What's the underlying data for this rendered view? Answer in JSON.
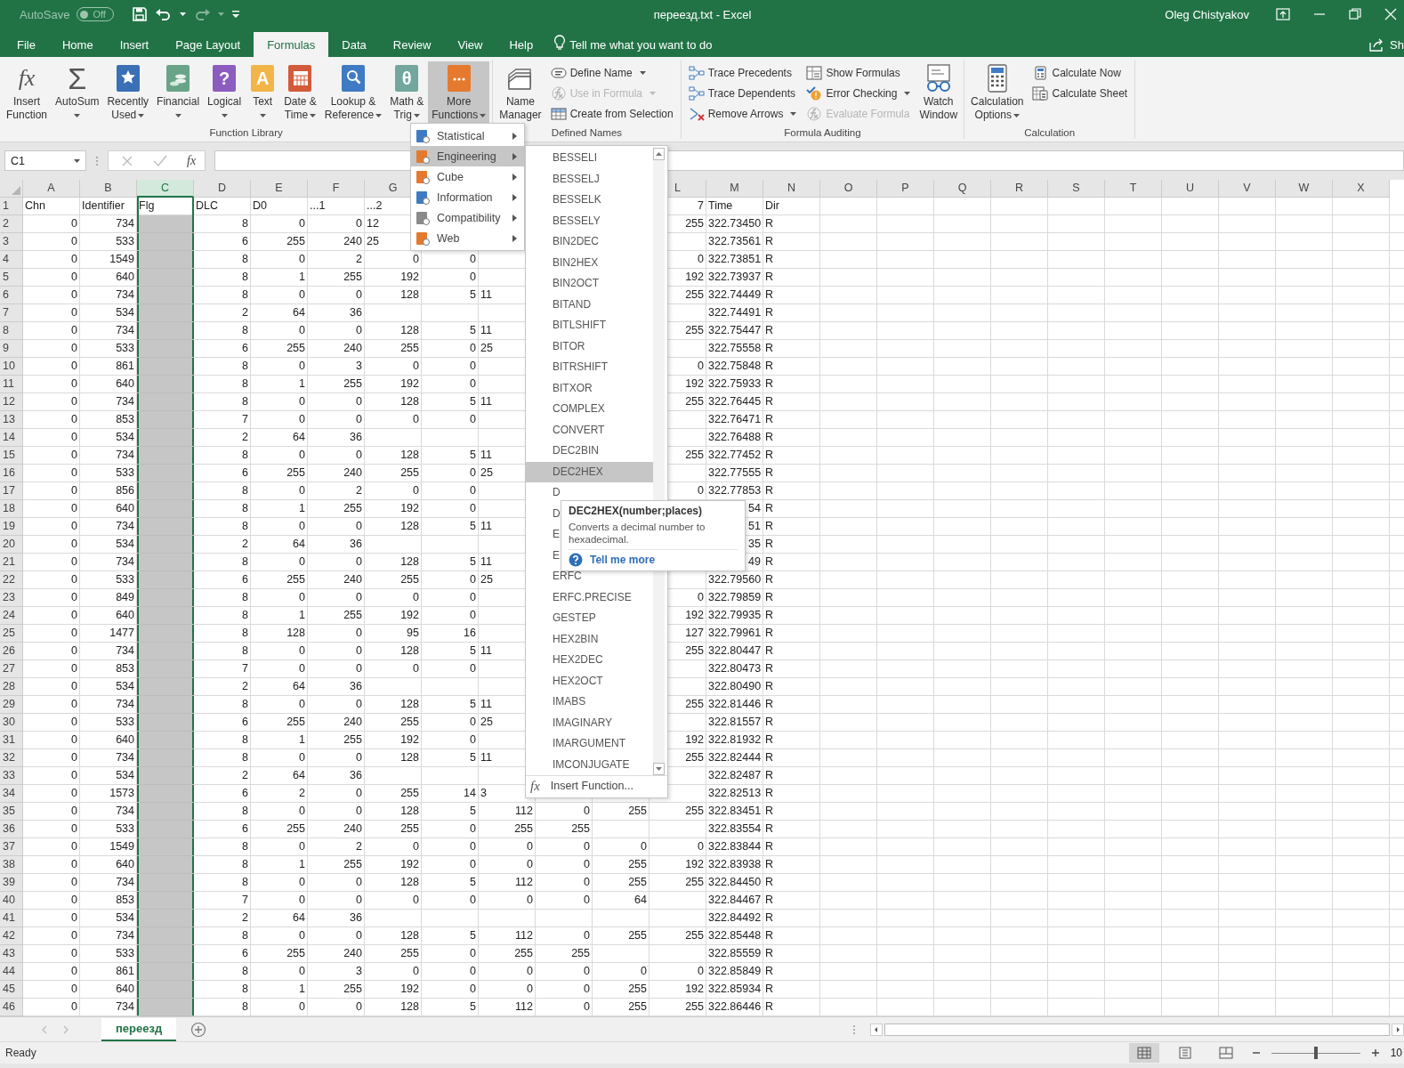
{
  "title_bar": {
    "autosave_label": "AutoSave",
    "autosave": {
      "on": false,
      "label": "Off"
    },
    "title": "переезд.txt - Excel",
    "user": "Oleg Chistyakov"
  },
  "tabs": [
    {
      "label": "File",
      "selected": false
    },
    {
      "label": "Home",
      "selected": false
    },
    {
      "label": "Insert",
      "selected": false
    },
    {
      "label": "Page Layout",
      "selected": false
    },
    {
      "label": "Formulas",
      "selected": true
    },
    {
      "label": "Data",
      "selected": false
    },
    {
      "label": "Review",
      "selected": false
    },
    {
      "label": "View",
      "selected": false
    },
    {
      "label": "Help",
      "selected": false
    }
  ],
  "tell_me": {
    "placeholder": "Tell me what you want to do"
  },
  "share": {
    "label": "Sh"
  },
  "ribbon_groups": [
    {
      "name": "Function Library",
      "items": [
        {
          "kind": "large",
          "lines": [
            "Insert",
            "Function"
          ],
          "glyph": "fx",
          "caret": false,
          "pressed": false
        },
        {
          "kind": "large",
          "lines": [
            "AutoSum"
          ],
          "glyph": "Σ",
          "caret": true,
          "pressed": false
        },
        {
          "kind": "large",
          "lines": [
            "Recently",
            "Used"
          ],
          "caret": true,
          "pressed": false
        },
        {
          "kind": "large",
          "lines": [
            "Financial"
          ],
          "caret": true,
          "pressed": false
        },
        {
          "kind": "large",
          "lines": [
            "Logical"
          ],
          "glyph": "?",
          "caret": true,
          "pressed": false
        },
        {
          "kind": "large",
          "lines": [
            "Text"
          ],
          "glyph": "A",
          "caret": true,
          "pressed": false
        },
        {
          "kind": "large",
          "lines": [
            "Date &",
            "Time"
          ],
          "caret": true,
          "pressed": false
        },
        {
          "kind": "large",
          "lines": [
            "Lookup &",
            "Reference"
          ],
          "caret": true,
          "pressed": false
        },
        {
          "kind": "large",
          "lines": [
            "Math &",
            "Trig"
          ],
          "glyph": "θ",
          "caret": true,
          "pressed": false
        },
        {
          "kind": "large",
          "lines": [
            "More",
            "Functions"
          ],
          "caret": true,
          "pressed": true
        }
      ]
    },
    {
      "name": "Defined Names",
      "items": [
        {
          "kind": "large",
          "lines": [
            "Name",
            "Manager"
          ],
          "caret": false,
          "pressed": false
        },
        {
          "kind": "stack",
          "buttons": [
            {
              "label": "Define Name",
              "caret": true,
              "disabled": false
            },
            {
              "label": "Use in Formula",
              "caret": true,
              "disabled": true
            },
            {
              "label": "Create from Selection",
              "caret": false,
              "disabled": false
            }
          ]
        }
      ]
    },
    {
      "name": "Formula Auditing",
      "items": [
        {
          "kind": "stack",
          "buttons": [
            {
              "label": "Trace Precedents",
              "caret": false,
              "disabled": false
            },
            {
              "label": "Trace Dependents",
              "caret": false,
              "disabled": false
            },
            {
              "label": "Remove Arrows",
              "caret": true,
              "disabled": false
            }
          ]
        },
        {
          "kind": "stack",
          "buttons": [
            {
              "label": "Show Formulas",
              "caret": false,
              "disabled": false
            },
            {
              "label": "Error Checking",
              "caret": true,
              "disabled": false
            },
            {
              "label": "Evaluate Formula",
              "caret": false,
              "disabled": true
            }
          ]
        },
        {
          "kind": "large",
          "lines": [
            "Watch",
            "Window"
          ],
          "caret": false,
          "pressed": false
        }
      ]
    },
    {
      "name": "Calculation",
      "items": [
        {
          "kind": "large",
          "lines": [
            "Calculation",
            "Options"
          ],
          "caret": true,
          "pressed": false
        },
        {
          "kind": "stack",
          "buttons": [
            {
              "label": "Calculate Now",
              "caret": false,
              "disabled": false
            },
            {
              "label": "Calculate Sheet",
              "caret": false,
              "disabled": false
            }
          ]
        }
      ]
    }
  ],
  "formula_bar": {
    "name_box": "C1",
    "fx": "fx"
  },
  "grid": {
    "columns": [
      {
        "label": "A",
        "selected": false
      },
      {
        "label": "B",
        "selected": false
      },
      {
        "label": "C",
        "selected": true
      },
      {
        "label": "D",
        "selected": false
      },
      {
        "label": "E",
        "selected": false
      },
      {
        "label": "F",
        "selected": false
      },
      {
        "label": "G",
        "selected": false
      },
      {},
      {},
      {},
      {},
      {
        "label": "L",
        "selected": false
      },
      {
        "label": "M",
        "selected": false
      },
      {
        "label": "N",
        "selected": false
      },
      {
        "label": "O",
        "selected": false
      },
      {
        "label": "P",
        "selected": false
      },
      {
        "label": "Q",
        "selected": false
      },
      {
        "label": "R",
        "selected": false
      },
      {
        "label": "S",
        "selected": false
      },
      {
        "label": "T",
        "selected": false
      },
      {
        "label": "U",
        "selected": false
      },
      {
        "label": "V",
        "selected": false
      },
      {
        "label": "W",
        "selected": false
      },
      {
        "label": "X",
        "selected": false
      }
    ],
    "rows": [
      {
        "n": "1",
        "cells": [
          "Chn",
          "Identifier",
          "Flg",
          "DLC",
          "D0",
          "...1",
          "...2",
          null,
          null,
          null,
          null,
          {
            "text": "7",
            "cut": true
          },
          "Time",
          "Dir"
        ]
      },
      {
        "n": "2",
        "cells": [
          "0",
          "734",
          null,
          "8",
          "0",
          "0",
          {
            "text": "12",
            "cut": true
          },
          null,
          null,
          null,
          null,
          "255",
          "322.73450",
          "R"
        ]
      },
      {
        "n": "3",
        "cells": [
          "0",
          "533",
          null,
          "6",
          "255",
          "240",
          {
            "text": "25",
            "cut": true
          },
          null,
          null,
          null,
          null,
          null,
          "322.73561",
          "R"
        ]
      },
      {
        "n": "4",
        "cells": [
          "0",
          "1549",
          null,
          "8",
          "0",
          "2",
          "0",
          "0",
          null,
          null,
          null,
          "0",
          "322.73851",
          "R"
        ]
      },
      {
        "n": "5",
        "cells": [
          "0",
          "640",
          null,
          "8",
          "1",
          "255",
          "192",
          "0",
          null,
          null,
          null,
          "192",
          "322.73937",
          "R"
        ]
      },
      {
        "n": "6",
        "cells": [
          "0",
          "734",
          null,
          "8",
          "0",
          "0",
          "128",
          "5",
          {
            "text": "11",
            "cut": true
          },
          null,
          null,
          "255",
          "322.74449",
          "R"
        ]
      },
      {
        "n": "7",
        "cells": [
          "0",
          "534",
          null,
          "2",
          "64",
          "36",
          null,
          null,
          null,
          null,
          null,
          null,
          "322.74491",
          "R"
        ]
      },
      {
        "n": "8",
        "cells": [
          "0",
          "734",
          null,
          "8",
          "0",
          "0",
          "128",
          "5",
          {
            "text": "11",
            "cut": true
          },
          null,
          null,
          "255",
          "322.75447",
          "R"
        ]
      },
      {
        "n": "9",
        "cells": [
          "0",
          "533",
          null,
          "6",
          "255",
          "240",
          "255",
          "0",
          {
            "text": "25",
            "cut": true
          },
          null,
          null,
          null,
          "322.75558",
          "R"
        ]
      },
      {
        "n": "10",
        "cells": [
          "0",
          "861",
          null,
          "8",
          "0",
          "3",
          "0",
          "0",
          null,
          null,
          null,
          "0",
          "322.75848",
          "R"
        ]
      },
      {
        "n": "11",
        "cells": [
          "0",
          "640",
          null,
          "8",
          "1",
          "255",
          "192",
          "0",
          null,
          null,
          null,
          "192",
          "322.75933",
          "R"
        ]
      },
      {
        "n": "12",
        "cells": [
          "0",
          "734",
          null,
          "8",
          "0",
          "0",
          "128",
          "5",
          {
            "text": "11",
            "cut": true
          },
          null,
          null,
          "255",
          "322.76445",
          "R"
        ]
      },
      {
        "n": "13",
        "cells": [
          "0",
          "853",
          null,
          "7",
          "0",
          "0",
          "0",
          "0",
          null,
          null,
          null,
          null,
          "322.76471",
          "R"
        ]
      },
      {
        "n": "14",
        "cells": [
          "0",
          "534",
          null,
          "2",
          "64",
          "36",
          null,
          null,
          null,
          null,
          null,
          null,
          "322.76488",
          "R"
        ]
      },
      {
        "n": "15",
        "cells": [
          "0",
          "734",
          null,
          "8",
          "0",
          "0",
          "128",
          "5",
          {
            "text": "11",
            "cut": true
          },
          null,
          null,
          "255",
          "322.77452",
          "R"
        ]
      },
      {
        "n": "16",
        "cells": [
          "0",
          "533",
          null,
          "6",
          "255",
          "240",
          "255",
          "0",
          {
            "text": "25",
            "cut": true
          },
          null,
          null,
          null,
          "322.77555",
          "R"
        ]
      },
      {
        "n": "17",
        "cells": [
          "0",
          "856",
          null,
          "8",
          "0",
          "2",
          "0",
          "0",
          null,
          null,
          null,
          "0",
          "322.77853",
          "R"
        ]
      },
      {
        "n": "18",
        "cells": [
          "0",
          "640",
          null,
          "8",
          "1",
          "255",
          "192",
          "0",
          null,
          null,
          null,
          null,
          "54",
          "R"
        ]
      },
      {
        "n": "19",
        "cells": [
          "0",
          "734",
          null,
          "8",
          "0",
          "0",
          "128",
          "5",
          {
            "text": "11",
            "cut": true
          },
          null,
          null,
          null,
          "51",
          "R"
        ]
      },
      {
        "n": "20",
        "cells": [
          "0",
          "534",
          null,
          "2",
          "64",
          "36",
          null,
          null,
          null,
          null,
          null,
          null,
          "35",
          "R"
        ]
      },
      {
        "n": "21",
        "cells": [
          "0",
          "734",
          null,
          "8",
          "0",
          "0",
          "128",
          "5",
          {
            "text": "11",
            "cut": true
          },
          null,
          null,
          null,
          "49",
          "R"
        ]
      },
      {
        "n": "22",
        "cells": [
          "0",
          "533",
          null,
          "6",
          "255",
          "240",
          "255",
          "0",
          {
            "text": "25",
            "cut": true
          },
          null,
          null,
          null,
          "322.79560",
          "R"
        ]
      },
      {
        "n": "23",
        "cells": [
          "0",
          "849",
          null,
          "8",
          "0",
          "0",
          "0",
          "0",
          null,
          null,
          null,
          "0",
          "322.79859",
          "R"
        ]
      },
      {
        "n": "24",
        "cells": [
          "0",
          "640",
          null,
          "8",
          "1",
          "255",
          "192",
          "0",
          null,
          null,
          null,
          "192",
          "322.79935",
          "R"
        ]
      },
      {
        "n": "25",
        "cells": [
          "0",
          "1477",
          null,
          "8",
          "128",
          "0",
          "95",
          "16",
          null,
          null,
          null,
          "127",
          "322.79961",
          "R"
        ]
      },
      {
        "n": "26",
        "cells": [
          "0",
          "734",
          null,
          "8",
          "0",
          "0",
          "128",
          "5",
          {
            "text": "11",
            "cut": true
          },
          null,
          null,
          "255",
          "322.80447",
          "R"
        ]
      },
      {
        "n": "27",
        "cells": [
          "0",
          "853",
          null,
          "7",
          "0",
          "0",
          "0",
          "0",
          null,
          null,
          null,
          null,
          "322.80473",
          "R"
        ]
      },
      {
        "n": "28",
        "cells": [
          "0",
          "534",
          null,
          "2",
          "64",
          "36",
          null,
          null,
          null,
          null,
          null,
          null,
          "322.80490",
          "R"
        ]
      },
      {
        "n": "29",
        "cells": [
          "0",
          "734",
          null,
          "8",
          "0",
          "0",
          "128",
          "5",
          {
            "text": "11",
            "cut": true
          },
          null,
          null,
          "255",
          "322.81446",
          "R"
        ]
      },
      {
        "n": "30",
        "cells": [
          "0",
          "533",
          null,
          "6",
          "255",
          "240",
          "255",
          "0",
          {
            "text": "25",
            "cut": true
          },
          null,
          null,
          null,
          "322.81557",
          "R"
        ]
      },
      {
        "n": "31",
        "cells": [
          "0",
          "640",
          null,
          "8",
          "1",
          "255",
          "192",
          "0",
          null,
          null,
          null,
          "192",
          "322.81932",
          "R"
        ]
      },
      {
        "n": "32",
        "cells": [
          "0",
          "734",
          null,
          "8",
          "0",
          "0",
          "128",
          "5",
          {
            "text": "11",
            "cut": true
          },
          null,
          null,
          "255",
          "322.82444",
          "R"
        ]
      },
      {
        "n": "33",
        "cells": [
          "0",
          "534",
          null,
          "2",
          "64",
          "36",
          null,
          null,
          null,
          null,
          null,
          null,
          "322.82487",
          "R"
        ]
      },
      {
        "n": "34",
        "cells": [
          "0",
          "1573",
          null,
          "6",
          "2",
          "0",
          "255",
          "14",
          {
            "text": "3",
            "cut": true
          },
          null,
          null,
          null,
          "322.82513",
          "R"
        ]
      },
      {
        "n": "35",
        "cells": [
          "0",
          "734",
          null,
          "8",
          "0",
          "0",
          "128",
          "5",
          "112",
          "0",
          "255",
          "255",
          "322.83451",
          "R"
        ]
      },
      {
        "n": "36",
        "cells": [
          "0",
          "533",
          null,
          "6",
          "255",
          "240",
          "255",
          "0",
          "255",
          "255",
          null,
          null,
          "322.83554",
          "R"
        ]
      },
      {
        "n": "37",
        "cells": [
          "0",
          "1549",
          null,
          "8",
          "0",
          "2",
          "0",
          "0",
          "0",
          "0",
          "0",
          "0",
          "322.83844",
          "R"
        ]
      },
      {
        "n": "38",
        "cells": [
          "0",
          "640",
          null,
          "8",
          "1",
          "255",
          "192",
          "0",
          "0",
          "0",
          "255",
          "192",
          "322.83938",
          "R"
        ]
      },
      {
        "n": "39",
        "cells": [
          "0",
          "734",
          null,
          "8",
          "0",
          "0",
          "128",
          "5",
          "112",
          "0",
          "255",
          "255",
          "322.84450",
          "R"
        ]
      },
      {
        "n": "40",
        "cells": [
          "0",
          "853",
          null,
          "7",
          "0",
          "0",
          "0",
          "0",
          "0",
          "0",
          "64",
          null,
          "322.84467",
          "R"
        ]
      },
      {
        "n": "41",
        "cells": [
          "0",
          "534",
          null,
          "2",
          "64",
          "36",
          null,
          null,
          null,
          null,
          null,
          null,
          "322.84492",
          "R"
        ]
      },
      {
        "n": "42",
        "cells": [
          "0",
          "734",
          null,
          "8",
          "0",
          "0",
          "128",
          "5",
          "112",
          "0",
          "255",
          "255",
          "322.85448",
          "R"
        ]
      },
      {
        "n": "43",
        "cells": [
          "0",
          "533",
          null,
          "6",
          "255",
          "240",
          "255",
          "0",
          "255",
          "255",
          null,
          null,
          "322.85559",
          "R"
        ]
      },
      {
        "n": "44",
        "cells": [
          "0",
          "861",
          null,
          "8",
          "0",
          "3",
          "0",
          "0",
          "0",
          "0",
          "0",
          "0",
          "322.85849",
          "R"
        ]
      },
      {
        "n": "45",
        "cells": [
          "0",
          "640",
          null,
          "8",
          "1",
          "255",
          "192",
          "0",
          "0",
          "0",
          "255",
          "192",
          "322.85934",
          "R"
        ]
      },
      {
        "n": "46",
        "cells": [
          "0",
          "734",
          null,
          "8",
          "0",
          "0",
          "128",
          "5",
          "112",
          "0",
          "255",
          "255",
          "322.86446",
          "R"
        ]
      }
    ]
  },
  "more_functions_menu": {
    "items": [
      {
        "label": "Statistical",
        "selected": false
      },
      {
        "label": "Engineering",
        "selected": true
      },
      {
        "label": "Cube",
        "selected": false
      },
      {
        "label": "Information",
        "selected": false
      },
      {
        "label": "Compatibility",
        "selected": false
      },
      {
        "label": "Web",
        "selected": false
      }
    ]
  },
  "engineering_submenu": {
    "items": [
      {
        "label": "BESSELI",
        "selected": false
      },
      {
        "label": "BESSELJ",
        "selected": false
      },
      {
        "label": "BESSELK",
        "selected": false
      },
      {
        "label": "BESSELY",
        "selected": false
      },
      {
        "label": "BIN2DEC",
        "selected": false
      },
      {
        "label": "BIN2HEX",
        "selected": false
      },
      {
        "label": "BIN2OCT",
        "selected": false
      },
      {
        "label": "BITAND",
        "selected": false
      },
      {
        "label": "BITLSHIFT",
        "selected": false
      },
      {
        "label": "BITOR",
        "selected": false
      },
      {
        "label": "BITRSHIFT",
        "selected": false
      },
      {
        "label": "BITXOR",
        "selected": false
      },
      {
        "label": "COMPLEX",
        "selected": false
      },
      {
        "label": "CONVERT",
        "selected": false
      },
      {
        "label": "DEC2BIN",
        "selected": false
      },
      {
        "label": "DEC2HEX",
        "selected": true
      },
      {
        "label": "D",
        "selected": false
      },
      {
        "label": "D",
        "selected": false
      },
      {
        "label": "E",
        "selected": false
      },
      {
        "label": "E",
        "selected": false
      },
      {
        "label": "ERFC",
        "selected": false
      },
      {
        "label": "ERFC.PRECISE",
        "selected": false
      },
      {
        "label": "GESTEP",
        "selected": false
      },
      {
        "label": "HEX2BIN",
        "selected": false
      },
      {
        "label": "HEX2DEC",
        "selected": false
      },
      {
        "label": "HEX2OCT",
        "selected": false
      },
      {
        "label": "IMABS",
        "selected": false
      },
      {
        "label": "IMAGINARY",
        "selected": false
      },
      {
        "label": "IMARGUMENT",
        "selected": false
      },
      {
        "label": "IMCONJUGATE",
        "selected": false
      }
    ],
    "footer": {
      "glyph": "fx",
      "label": "Insert Function..."
    }
  },
  "tooltip": {
    "title": "DEC2HEX(number;places)",
    "description": "Converts a decimal number to hexadecimal.",
    "link": "Tell me more"
  },
  "sheet_tabs": [
    {
      "label": "переезд",
      "selected": true
    }
  ],
  "status_bar": {
    "text": "Ready",
    "views": [
      {
        "selected": true
      },
      {
        "selected": false
      },
      {
        "selected": false
      }
    ],
    "zoom": {
      "level": 0.5,
      "label": "10"
    }
  }
}
